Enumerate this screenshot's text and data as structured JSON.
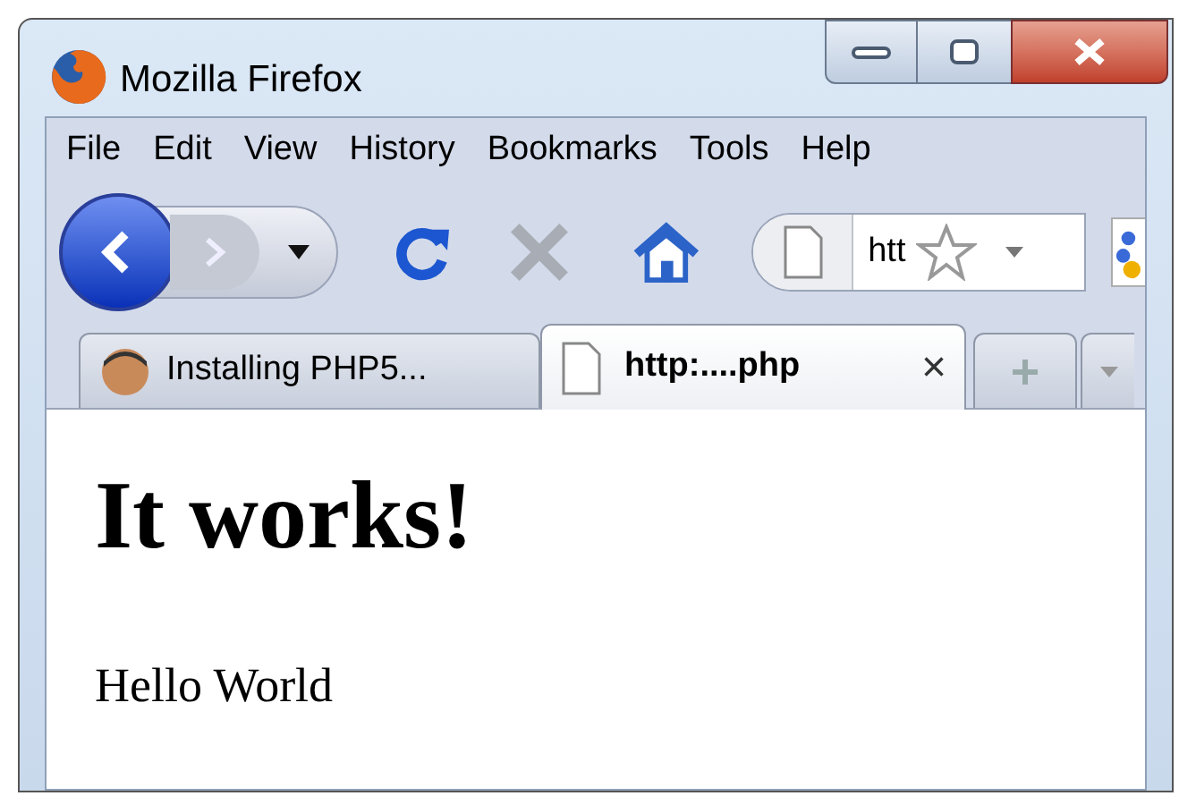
{
  "window": {
    "title": "Mozilla Firefox"
  },
  "menu": [
    "File",
    "Edit",
    "View",
    "History",
    "Bookmarks",
    "Tools",
    "Help"
  ],
  "address": {
    "value": "htt"
  },
  "tabs": [
    {
      "label": "Installing PHP5...",
      "selected": false,
      "kind": "avatar"
    },
    {
      "label": "http:....php",
      "selected": true,
      "kind": "page",
      "close": "×"
    }
  ],
  "content": {
    "heading": "It works!",
    "text": "Hello World"
  }
}
